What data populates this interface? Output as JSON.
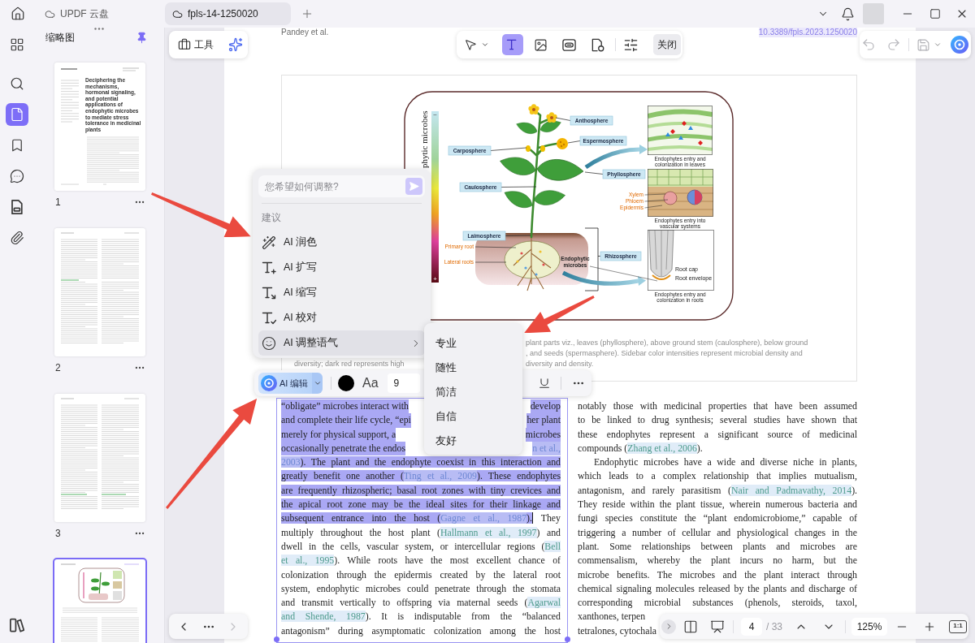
{
  "title_bar": {
    "tabs": [
      {
        "label": "UPDF 云盘",
        "selected": false
      },
      {
        "label": "fpls-14-1250020",
        "selected": true
      }
    ]
  },
  "rail": [
    {
      "selected": false
    },
    {
      "selected": false
    },
    {
      "selected": true
    },
    {
      "selected": false
    },
    {
      "selected": false
    },
    {
      "selected": false
    },
    {
      "selected": false
    },
    {
      "selected": false
    }
  ],
  "thumbnails": {
    "title": "缩略图",
    "pages": [
      {
        "label": "1",
        "selected": false,
        "title": "Deciphering the mechanisms, hormonal signaling, and potential applications of endophytic microbes to mediate stress tolerance in medicinal plants"
      },
      {
        "label": "2",
        "selected": false
      },
      {
        "label": "3",
        "selected": false
      },
      {
        "selected": true
      }
    ]
  },
  "toolbar": {
    "tools_label": "工具",
    "modes": [
      {
        "selected": false
      },
      {
        "selected": true
      },
      {
        "selected": false
      },
      {
        "selected": false
      },
      {
        "selected": false
      }
    ],
    "close_label": "关闭"
  },
  "page": {
    "running_head": "Pandey et al.",
    "doi": "10.3389/fpls.2023.1250020",
    "figure": {
      "scale_title": "phytic microbes",
      "scale_labels": [
        "−",
        "+"
      ],
      "zones": [
        "Anthosphere",
        "Espermosphere",
        "Carposphere",
        "Phyllosphere",
        "Caulosphere",
        "Laimosphere",
        "Rhizosphere"
      ],
      "root_labels": [
        "Primary root",
        "Lateral roots"
      ],
      "microbe_label": [
        "Endophytic",
        "microbes"
      ],
      "tissue_labels": [
        "Xylem",
        "Phloem",
        "Epidermis"
      ],
      "root_tip_labels": [
        "Root cap",
        "Root envelope"
      ],
      "insets": [
        {
          "caption": [
            "Endophytes entry and",
            "colonization in leaves"
          ]
        },
        {
          "caption": [
            "Endophytes entry into",
            "vascular systems"
          ]
        },
        {
          "caption": [
            "Endophytes entry and",
            "colonization in roots"
          ]
        }
      ],
      "caption": [
        {
          "parts": [
            "plant parts viz., leaves (phyllosphere), above ground stem (caulosphere), below ground"
          ]
        },
        {
          "parts": [
            ", and seeds (spermasphere). Sidebar color intensities represent microbial density and"
          ]
        },
        {
          "parts": [
            "diversity; dark red represents high",
            "diversity and density."
          ]
        }
      ]
    },
    "columns": [
      {
        "lines": [
          {
            "kind": "split",
            "segments": [
              {
                "text": "“obligate” microbes interact with",
                "kind": "text",
                "selected": true
              },
              {
                "text": "develop",
                "kind": "text",
                "selected": true
              }
            ]
          },
          {
            "kind": "split",
            "segments": [
              {
                "text": "and complete their life cycle, “epi",
                "kind": "text",
                "selected": true
              },
              {
                "text": "her plant",
                "kind": "text",
                "selected": true
              }
            ]
          },
          {
            "kind": "split",
            "segments": [
              {
                "text": "merely for physical support, a",
                "kind": "text",
                "selected": true
              },
              {
                "text": "microbes",
                "kind": "text",
                "selected": true
              }
            ]
          },
          {
            "kind": "split",
            "segments": [
              {
                "text": "occasionally penetrate the endos",
                "kind": "text",
                "selected": true
              },
              {
                "text": "n et al.,",
                "kind": "citation",
                "selected": true
              }
            ]
          },
          {
            "kind": "justified",
            "segments": [
              {
                "text": "2003",
                "kind": "citation",
                "selected": true
              },
              {
                "text": "). The plant and the endophyte coexist in this interaction and",
                "kind": "text",
                "selected": true
              }
            ]
          },
          {
            "kind": "justified",
            "segments": [
              {
                "text": "greatly benefit one another (",
                "kind": "text",
                "selected": true
              },
              {
                "text": "Ting et al., 2009",
                "kind": "citation",
                "selected": true
              },
              {
                "text": "). These endophytes",
                "kind": "text",
                "selected": true
              }
            ]
          },
          {
            "kind": "justified",
            "segments": [
              {
                "text": "are frequently rhizospheric; basal root zones with tiny crevices and",
                "kind": "text",
                "selected": true
              }
            ]
          },
          {
            "kind": "justified",
            "segments": [
              {
                "text": "the apical root zone may be the ideal sites for their linkage and",
                "kind": "text",
                "selected": true
              }
            ]
          },
          {
            "kind": "justified",
            "segments": [
              {
                "text": "subsequent entrance into the host (",
                "kind": "text",
                "selected": true
              },
              {
                "text": "Gagne et al., 1987",
                "kind": "citation",
                "selected": true
              },
              {
                "text": ").",
                "kind": "text",
                "selected": true
              },
              {
                "text": " They",
                "kind": "text",
                "selected": false
              }
            ]
          },
          {
            "kind": "justified",
            "segments": [
              {
                "text": "multiply throughout the host plant (",
                "kind": "text",
                "selected": false
              },
              {
                "text": "Hallmann et al., 1997",
                "kind": "citation",
                "selected": false
              },
              {
                "text": ") and",
                "kind": "text",
                "selected": false
              }
            ]
          },
          {
            "kind": "justified",
            "segments": [
              {
                "text": "dwell in the cells, vascular system, or intercellular regions (",
                "kind": "text",
                "selected": false
              },
              {
                "text": "Bell",
                "kind": "citation",
                "selected": false
              }
            ]
          },
          {
            "kind": "justified",
            "segments": [
              {
                "text": "et al., 1995",
                "kind": "citation",
                "selected": false
              },
              {
                "text": "). While roots have the most excellent chance of",
                "kind": "text",
                "selected": false
              }
            ]
          },
          {
            "kind": "justified",
            "segments": [
              {
                "text": "colonization through the epidermis created by the lateral root",
                "kind": "text",
                "selected": false
              }
            ]
          },
          {
            "kind": "justified",
            "segments": [
              {
                "text": "system, endophytic microbes could penetrate through the stomata",
                "kind": "text",
                "selected": false
              }
            ]
          },
          {
            "kind": "justified",
            "segments": [
              {
                "text": "and transmit vertically to offspring via maternal seeds (",
                "kind": "text",
                "selected": false
              },
              {
                "text": "Agarwal",
                "kind": "citation",
                "selected": false
              }
            ]
          },
          {
            "kind": "justified",
            "segments": [
              {
                "text": "and Shende, 1987",
                "kind": "citation",
                "selected": false
              },
              {
                "text": "). It is indisputable from the “balanced",
                "kind": "text",
                "selected": false
              }
            ]
          },
          {
            "kind": "justified",
            "segments": [
              {
                "text": "antagonism” during asymptomatic colonization among the host",
                "kind": "text",
                "selected": false
              }
            ]
          }
        ]
      },
      {
        "lines": [
          {
            "kind": "justified",
            "segments": [
              {
                "text": "notably those with medicinal properties that have been assumed",
                "kind": "text"
              }
            ]
          },
          {
            "kind": "justified",
            "segments": [
              {
                "text": "to be linked to drug synthesis; several studies have shown that",
                "kind": "text"
              }
            ]
          },
          {
            "kind": "justified",
            "segments": [
              {
                "text": "these endophytes represent a significant source of medicinal",
                "kind": "text"
              }
            ]
          },
          {
            "kind": "last",
            "segments": [
              {
                "text": "compounds (",
                "kind": "text"
              },
              {
                "text": "Zhang et al., 2006",
                "kind": "citation"
              },
              {
                "text": ").",
                "kind": "text"
              }
            ]
          },
          {
            "kind": "indent",
            "segments": [
              {
                "text": "Endophytic microbes have a wide and diverse niche in plants,",
                "kind": "text"
              }
            ]
          },
          {
            "kind": "justified",
            "segments": [
              {
                "text": "which leads to a complex relationship that implies mutualism,",
                "kind": "text"
              }
            ]
          },
          {
            "kind": "justified",
            "segments": [
              {
                "text": "antagonism, and rarely parasitism (",
                "kind": "text"
              },
              {
                "text": "Nair and Padmavathy, 2014",
                "kind": "citation"
              },
              {
                "text": ").",
                "kind": "text"
              }
            ]
          },
          {
            "kind": "justified",
            "segments": [
              {
                "text": "They reside within the plant tissue, wherein numerous bacteria and",
                "kind": "text"
              }
            ]
          },
          {
            "kind": "justified",
            "segments": [
              {
                "text": "fungi species constitute the “plant endomicrobiome,” capable of",
                "kind": "text"
              }
            ]
          },
          {
            "kind": "justified",
            "segments": [
              {
                "text": "triggering a number of cellular and physiological changes in the",
                "kind": "text"
              }
            ]
          },
          {
            "kind": "justified",
            "segments": [
              {
                "text": "plant. Some relationships between plants and microbes are",
                "kind": "text"
              }
            ]
          },
          {
            "kind": "justified",
            "segments": [
              {
                "text": "commensalism, whereby the plant incurs no harm, but the",
                "kind": "text"
              }
            ]
          },
          {
            "kind": "justified",
            "segments": [
              {
                "text": "microbe benefits. The microbes and the plant interact through",
                "kind": "text"
              }
            ]
          },
          {
            "kind": "justified",
            "segments": [
              {
                "text": "chemical signaling molecules released by the plants and discharge of",
                "kind": "text"
              }
            ]
          },
          {
            "kind": "justified",
            "segments": [
              {
                "text": "corresponding microbial substances (phenols, steroids, taxol,",
                "kind": "text"
              }
            ]
          },
          {
            "kind": "last",
            "segments": [
              {
                "text": "xanthones, terpen",
                "kind": "text"
              }
            ]
          },
          {
            "kind": "last",
            "segments": [
              {
                "text": "tetralones, cytochala",
                "kind": "text"
              }
            ]
          }
        ]
      }
    ]
  },
  "ai_menu": {
    "placeholder": "您希望如何调整?",
    "section": "建议",
    "items": [
      {
        "label": "AI 润色",
        "kind": "action",
        "selected": false
      },
      {
        "label": "AI 扩写",
        "kind": "action",
        "selected": false
      },
      {
        "label": "AI 缩写",
        "kind": "action",
        "selected": false
      },
      {
        "label": "AI 校对",
        "kind": "action",
        "selected": false
      },
      {
        "label": "AI 调整语气",
        "kind": "submenu",
        "selected": true
      }
    ]
  },
  "tone_menu": {
    "items": [
      {
        "label": "专业",
        "selected": false
      },
      {
        "label": "随性",
        "selected": false
      },
      {
        "label": "简洁",
        "selected": false
      },
      {
        "label": "自信",
        "selected": false
      },
      {
        "label": "友好",
        "selected": false
      }
    ]
  },
  "text_toolbar": {
    "ai_label": "AI 编辑",
    "font_label": "Aa",
    "font_size": "9"
  },
  "page_nav": {
    "page": "4",
    "total": "/ 33",
    "zoom": "125%",
    "actual_size": "1:1"
  }
}
